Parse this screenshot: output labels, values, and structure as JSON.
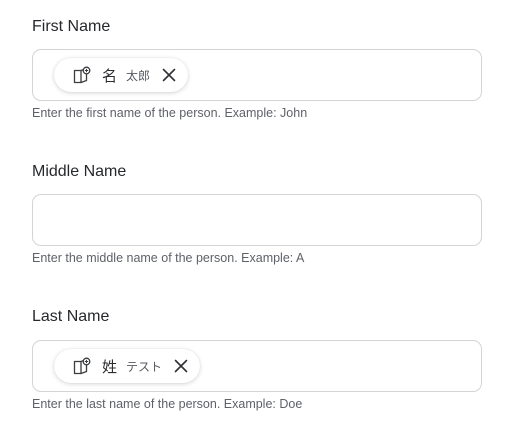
{
  "fields": [
    {
      "label": "First Name",
      "chip": {
        "key": "名",
        "value": "太郎",
        "icon": "book-translate-icon",
        "remove_icon": "close-icon"
      },
      "helper": "Enter the first name of the person. Example: John"
    },
    {
      "label": "Middle Name",
      "value": "",
      "helper": "Enter the middle name of the person. Example: A"
    },
    {
      "label": "Last Name",
      "chip": {
        "key": "姓",
        "value": "テスト",
        "icon": "book-translate-icon",
        "remove_icon": "close-icon"
      },
      "helper": "Enter the last name of the person. Example: Doe"
    }
  ]
}
